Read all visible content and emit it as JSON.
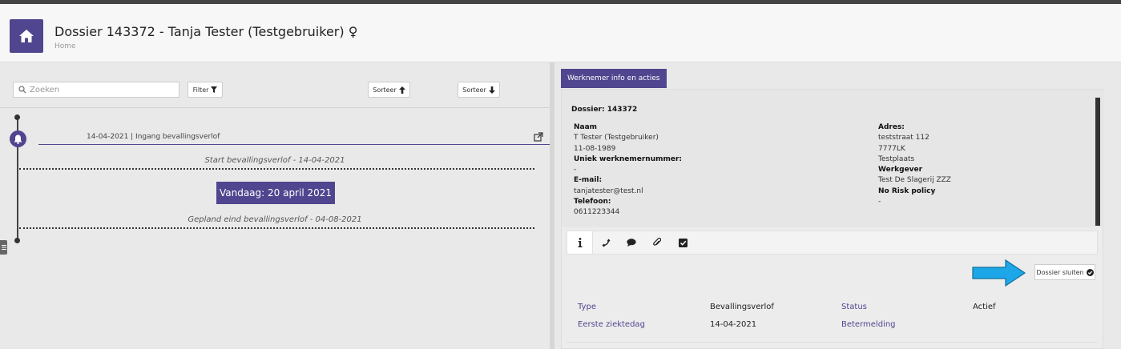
{
  "header": {
    "title": "Dossier 143372 - Tanja Tester (Testgebruiker) ♀",
    "breadcrumb": "Home"
  },
  "timeline_panel": {
    "search_placeholder": "Zoeken",
    "filter_label": "Filter",
    "sort_up_label": "Sorteer",
    "sort_down_label": "Sorteer",
    "event": "14-04-2021 | Ingang bevallingsverlof",
    "start_marker": "Start bevallingsverlof - 14-04-2021",
    "today_label": "Vandaag: 20 april 2021",
    "end_marker": "Gepland eind bevallingsverlof - 04-08-2021"
  },
  "employee_panel": {
    "tab_label": "Werknemer info en acties",
    "dossier": "Dossier: 143372",
    "naam_label": "Naam",
    "naam": "T Tester (Testgebruiker)",
    "geboortedatum": "11-08-1989",
    "werknemernummer_label": "Uniek werknemernummer:",
    "werknemernummer": "-",
    "email_label": "E-mail:",
    "email": "tanjatester@test.nl",
    "telefoon_label": "Telefoon:",
    "telefoon": "0611223344",
    "adres_label": "Adres:",
    "straat": "teststraat 112",
    "postcode": "7777LK",
    "plaats": "Testplaats",
    "werkgever_label": "Werkgever",
    "werkgever": "Test De Slagerij ZZZ",
    "norisk_label": "No Risk policy",
    "norisk": "-",
    "close_label": "Dossier sluiten",
    "type_label": "Type",
    "type_value": "Bevallingsverlof",
    "status_label": "Status",
    "status_value": "Actief",
    "ziektedag_label": "Eerste ziektedag",
    "ziektedag_value": "14-04-2021",
    "betermelding_label": "Betermelding"
  },
  "colors": {
    "accent": "#4f468f",
    "arrow": "#1ea7e8"
  }
}
